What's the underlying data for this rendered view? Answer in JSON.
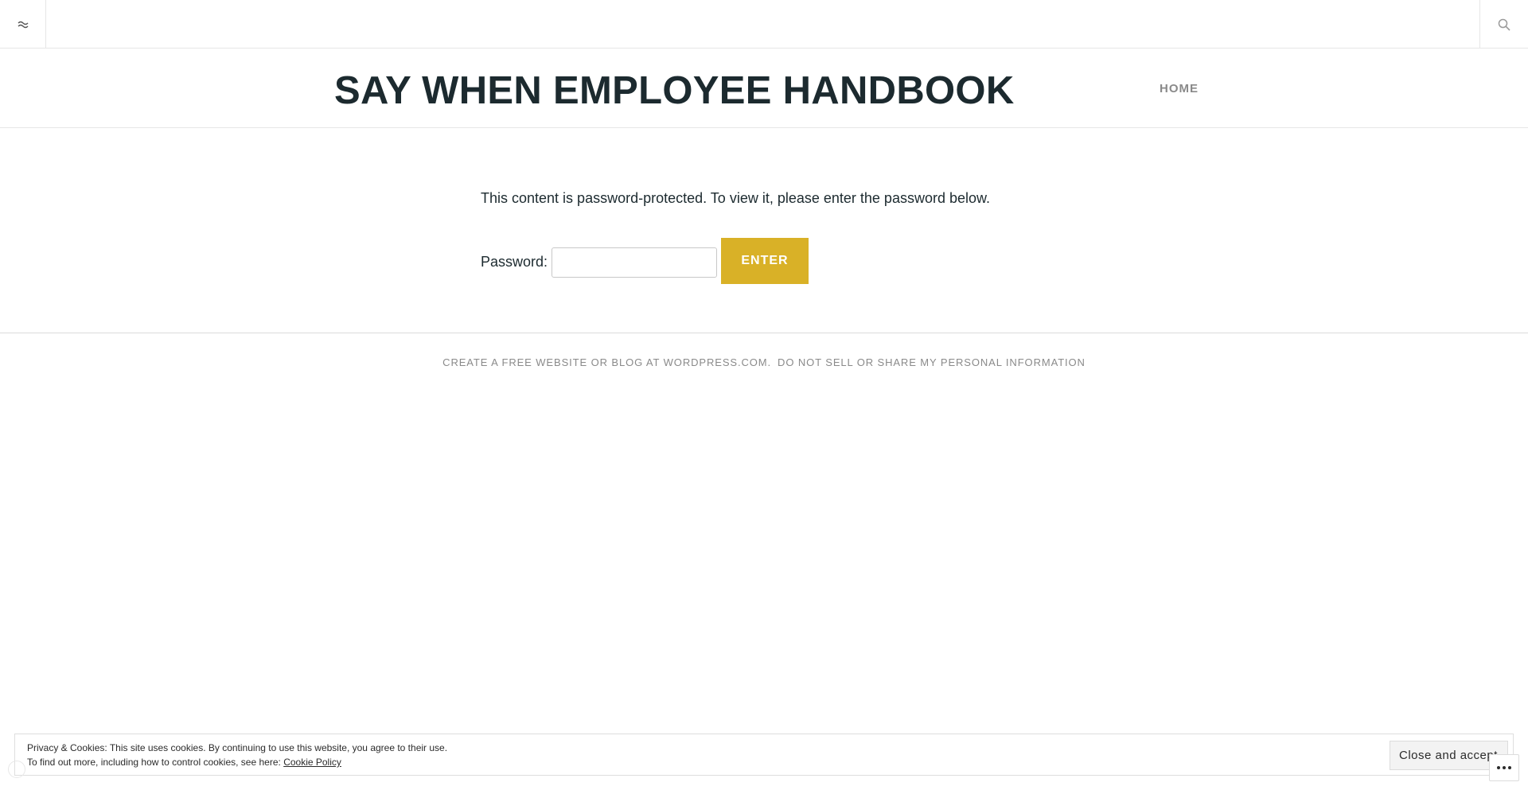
{
  "topbar": {
    "left_icon": "sidebar-toggle-icon",
    "right_icon": "search-icon"
  },
  "site": {
    "title": "SAY WHEN EMPLOYEE HANDBOOK"
  },
  "nav": {
    "home_label": "HOME"
  },
  "content": {
    "intro": "This content is password-protected. To view it, please enter the password below.",
    "password_label": "Password:",
    "password_value": "",
    "enter_label": "ENTER"
  },
  "footer": {
    "wordpress_link": "CREATE A FREE WEBSITE OR BLOG AT WORDPRESS.COM.",
    "privacy_link": "DO NOT SELL OR SHARE MY PERSONAL INFORMATION"
  },
  "cookie": {
    "line1": "Privacy & Cookies: This site uses cookies. By continuing to use this website, you agree to their use.",
    "line2": "To find out more, including how to control cookies, see here:",
    "policy_link": "Cookie Policy",
    "close_label": "Close and accept"
  },
  "colors": {
    "accent": "#d9b127",
    "title": "#1c2a2f",
    "muted": "#8a8a8a"
  }
}
